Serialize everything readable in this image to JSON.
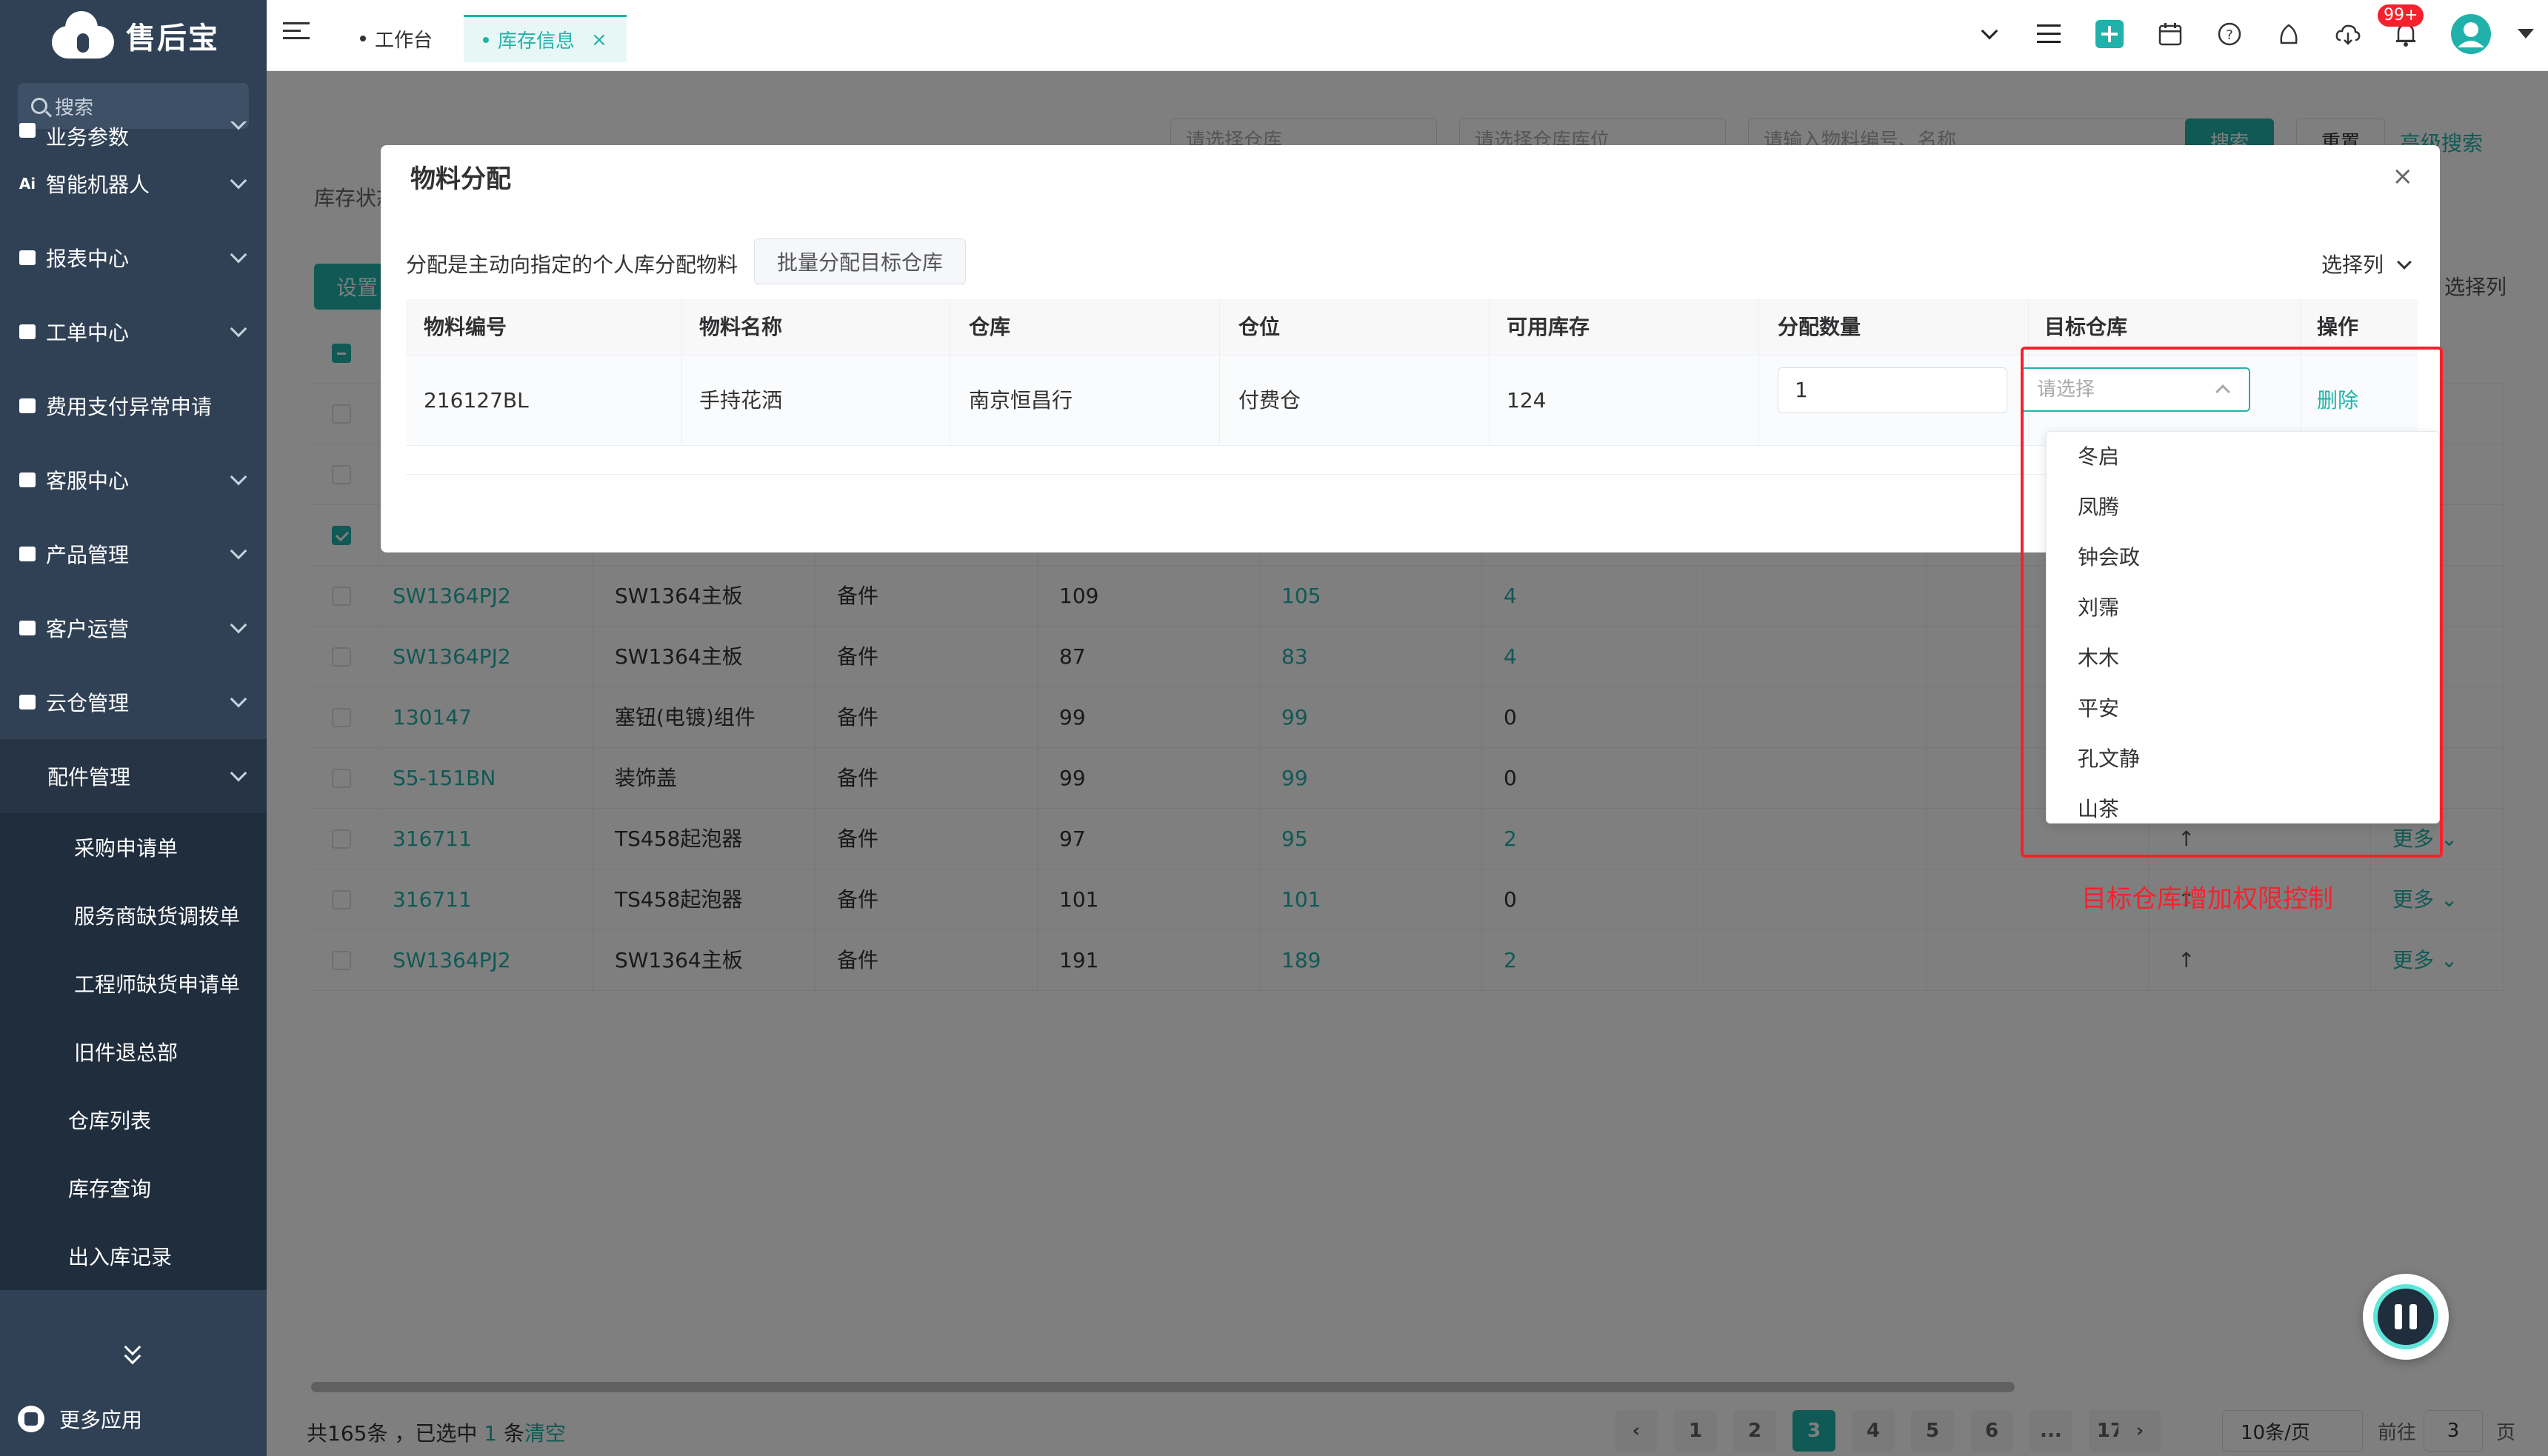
{
  "app": {
    "logo_text": "售后宝",
    "search_placeholder": "搜索"
  },
  "sidebar": {
    "partial_item": "业务参数",
    "items": [
      {
        "label": "智能机器人",
        "icon": "robot-icon"
      },
      {
        "label": "报表中心",
        "icon": "report-icon"
      },
      {
        "label": "工单中心",
        "icon": "workorder-icon"
      },
      {
        "label": "费用支付异常申请",
        "icon": "payment-icon"
      },
      {
        "label": "客服中心",
        "icon": "service-icon"
      },
      {
        "label": "产品管理",
        "icon": "product-icon"
      },
      {
        "label": "客户运营",
        "icon": "customer-icon"
      },
      {
        "label": "云仓管理",
        "icon": "warehouse-icon"
      }
    ],
    "open_item": "配件管理",
    "sub_items": [
      "采购申请单",
      "服务商缺货调拨单",
      "工程师缺货申请单",
      "旧件退总部"
    ],
    "sub_items_l2": [
      "仓库列表",
      "库存查询",
      "出入库记录"
    ],
    "footer": "更多应用"
  },
  "topbar": {
    "tabs": [
      {
        "label": "工作台",
        "active": false
      },
      {
        "label": "库存信息",
        "active": true,
        "close": "×"
      }
    ],
    "notification_badge": "99+"
  },
  "content": {
    "filters": [
      "请选择仓库",
      "请选择仓库库位",
      "请输入物料编号、名称"
    ],
    "search_btn": "搜索",
    "reset_btn": "重置",
    "advanced_search": "高级搜索",
    "stock_status_label": "库存状态",
    "set_btn": "设置",
    "select_columns": "选择列",
    "rows": [
      {
        "checked": false,
        "code": "",
        "name": "",
        "type": "",
        "v1": "",
        "v2": "",
        "v3": "",
        "partial": true
      },
      {
        "checked": false,
        "code": "",
        "name": "",
        "type": "",
        "v1": "",
        "v2": "",
        "v3": "",
        "partial": true
      },
      {
        "checked": true,
        "code": "",
        "name": "",
        "type": "",
        "v1": "",
        "v2": "",
        "v3": "",
        "partial": true
      },
      {
        "checked": false,
        "code": "SW1364PJ2",
        "name": "SW1364主板",
        "type": "备件",
        "v1": "109",
        "v2": "105",
        "v3": "4"
      },
      {
        "checked": false,
        "code": "SW1364PJ2",
        "name": "SW1364主板",
        "type": "备件",
        "v1": "87",
        "v2": "83",
        "v3": "4"
      },
      {
        "checked": false,
        "code": "130147",
        "name": "塞钮(电镀)组件",
        "type": "备件",
        "v1": "99",
        "v2": "99",
        "v3": "0"
      },
      {
        "checked": false,
        "code": "S5-151BN",
        "name": "装饰盖",
        "type": "备件",
        "v1": "99",
        "v2": "99",
        "v3": "0"
      },
      {
        "checked": false,
        "code": "316711",
        "name": "TS458起泡器",
        "type": "备件",
        "v1": "97",
        "v2": "95",
        "v3": "2",
        "more": "更多"
      },
      {
        "checked": false,
        "code": "316711",
        "name": "TS458起泡器",
        "type": "备件",
        "v1": "101",
        "v2": "101",
        "v3": "0",
        "more": "更多"
      },
      {
        "checked": false,
        "code": "SW1364PJ2",
        "name": "SW1364主板",
        "type": "备件",
        "v1": "191",
        "v2": "189",
        "v3": "2",
        "more": "更多"
      }
    ],
    "footer": {
      "total": "共165条",
      "selected_prefix": "，已选中",
      "selected_count": "1",
      "selected_suffix": "条",
      "clear": "清空",
      "pages": [
        "1",
        "2",
        "3",
        "4",
        "5",
        "6",
        "...",
        "17"
      ],
      "current_page": "3",
      "page_size": "10条/页",
      "goto_prefix": "前往",
      "goto_value": "3",
      "goto_suffix": "页"
    }
  },
  "dialog": {
    "title": "物料分配",
    "close": "×",
    "tip": "分配是主动向指定的个人库分配物料",
    "batch_btn": "批量分配目标仓库",
    "select_columns": "选择列",
    "headers": [
      "物料编号",
      "物料名称",
      "仓库",
      "仓位",
      "可用库存",
      "分配数量",
      "目标仓库",
      "操作"
    ],
    "row": {
      "code": "216127BL",
      "name": "手持花洒",
      "warehouse": "南京恒昌行",
      "location": "付费仓",
      "available": "124",
      "qty": "1",
      "target_placeholder": "请选择",
      "action": "删除"
    },
    "options": [
      "冬启",
      "凤腾",
      "钟会政",
      "刘霈",
      "木木",
      "平安",
      "孔文静",
      "山茶"
    ]
  },
  "annotation": "目标仓库增加权限控制",
  "colors": {
    "accent": "#20b2aa",
    "sidebar": "#304156",
    "annotation": "#f5222d"
  }
}
